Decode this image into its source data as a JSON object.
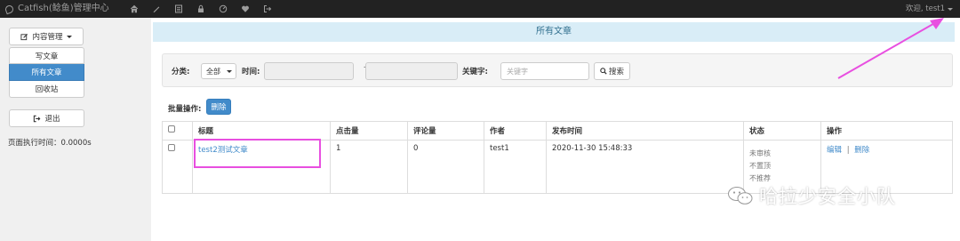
{
  "navbar": {
    "brand": "Catfish(鲶鱼)管理中心",
    "icons": [
      "home-icon",
      "pencil-icon",
      "list-icon",
      "lock-icon",
      "dashboard-icon",
      "heart-icon",
      "logout-icon"
    ],
    "welcome": "欢迎, test1"
  },
  "sidebar": {
    "menu_label": "内容管理",
    "items": [
      {
        "label": "写文章",
        "active": false
      },
      {
        "label": "所有文章",
        "active": true
      },
      {
        "label": "回收站",
        "active": false
      }
    ],
    "logout_label": "退出",
    "exec_time": "页面执行时间：0.0000s"
  },
  "main": {
    "title": "所有文章",
    "filter": {
      "category_label": "分类:",
      "category_value": "全部",
      "time_label": "时间:",
      "keyword_label": "关键字:",
      "keyword_placeholder": "关键字",
      "search_label": "搜索"
    },
    "batch_label": "批量操作:",
    "delete_label": "删除",
    "table": {
      "headers": [
        "标题",
        "点击量",
        "评论量",
        "作者",
        "发布时间",
        "状态",
        "操作"
      ],
      "rows": [
        {
          "title": "test2测试文章",
          "clicks": "1",
          "comments": "0",
          "author": "test1",
          "published": "2020-11-30 15:48:33",
          "status": [
            "未审核",
            "不置顶",
            "不推荐"
          ],
          "edit": "编辑",
          "separator": "|",
          "delete": "删除"
        }
      ]
    }
  },
  "watermark": "哈拉少安全小队",
  "colors": {
    "navbar": "#222222",
    "primary": "#428bca",
    "header_bg": "#d9edf7",
    "annotation": "#e84fe0"
  }
}
